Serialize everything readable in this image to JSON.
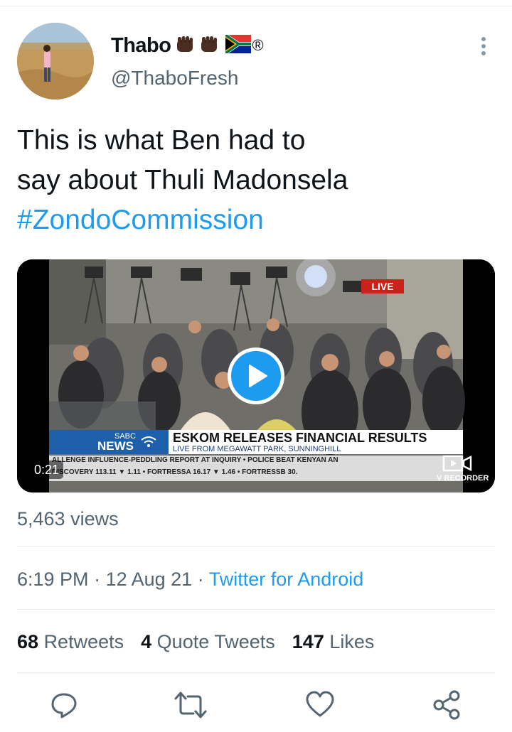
{
  "author": {
    "display_name": "Thabo",
    "emojis": [
      "raised-fist-icon",
      "raised-fist-icon",
      "south-africa-flag-icon"
    ],
    "registered_mark": "®",
    "handle": "@ThaboFresh"
  },
  "tweet": {
    "text_line1": "This is what Ben had to",
    "text_line2": "say about Thuli Madonsela",
    "hashtag": "#ZondoCommission"
  },
  "video": {
    "duration": "0:21",
    "live_badge": "LIVE",
    "channel_small": "SABC",
    "channel_big": "NEWS",
    "headline": "ESKOM RELEASES FINANCIAL RESULTS",
    "subheadline": "LIVE FROM MEGAWATT PARK, SUNNINGHILL",
    "ticker_line1": "ALLENGE INFLUENCE-PEDDLING REPORT AT INQUIRY   •   POLICE BEAT KENYAN AN",
    "ticker_line2": "DISCOVERY 113.11 ▼ 1.11  •  FORTRESSA 16.17 ▼ 1.46  •  FORTRESSB 30.",
    "recorder_label": "V RECORDER"
  },
  "views": "5,463 views",
  "meta": {
    "time": "6:19 PM",
    "separator": " · ",
    "date": "12 Aug 21",
    "source": "Twitter for Android"
  },
  "stats": {
    "retweets_count": "68",
    "retweets_label": "Retweets",
    "quotes_count": "4",
    "quotes_label": "Quote Tweets",
    "likes_count": "147",
    "likes_label": "Likes"
  },
  "colors": {
    "accent": "#1d9bf0",
    "secondary_text": "#536471",
    "primary_text": "#0f1419"
  }
}
